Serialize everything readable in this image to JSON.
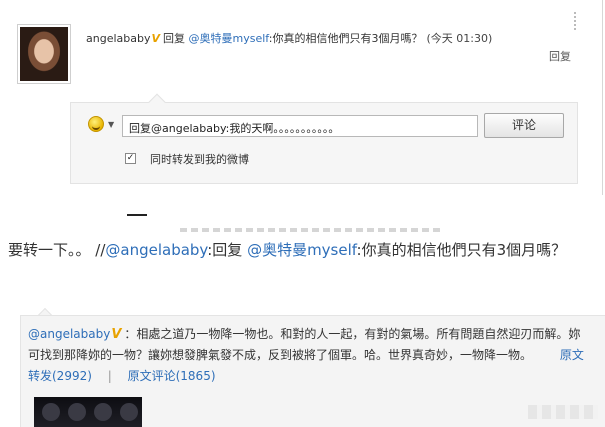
{
  "top": {
    "username": "angelababy",
    "verified_badge": "V",
    "reply_label": "回复",
    "mention_prefix": "@",
    "mentioned_user": "奥特曼myself",
    "status_text": ":你真的相信他們只有3個月嗎？",
    "time": "(今天  01:30)",
    "reply_right": "回复",
    "reply_input_value": "回复@angelababy:我的天啊。。。。。。。。。。。",
    "comment_button": "评论",
    "repost_checkbox_mark": "✓",
    "repost_label": "同时转发到我的微博",
    "emoticon_caret": "▼"
  },
  "repost": {
    "text_before": "要转一下。。  //",
    "mention1": "@angelababy",
    "text_mid": ":回复  ",
    "mention2": "@奥特曼myself",
    "text_after": ":你真的相信他們只有3個月嗎？"
  },
  "original": {
    "username": "@angelababy",
    "verified_badge": "V",
    "text": "：相處之道乃一物降一物也。和對的人一起，有對的氣場。所有問題自然迎刃而解。妳可找到那降妳的一物？讓妳想發脾氣發不成，反到被將了個軍。哈。世界真奇妙，一物降一物。",
    "repost_count_label": "原文转发(2992)",
    "comment_count_label": "原文评论(1865)",
    "separator": "|"
  },
  "colors": {
    "link": "#2e6eb8",
    "badge": "#e8a200",
    "panel": "#f6f6f6"
  }
}
